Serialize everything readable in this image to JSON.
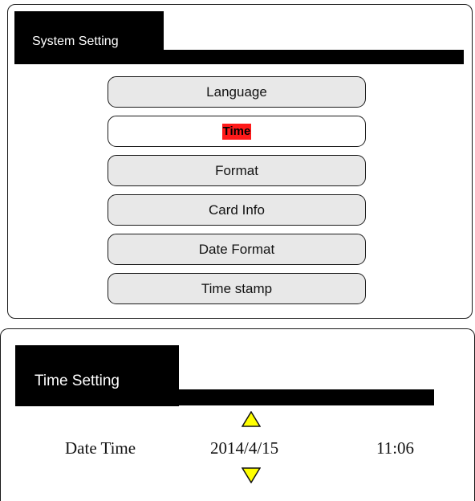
{
  "system_setting": {
    "title": "System Setting",
    "menu": [
      {
        "label": "Language",
        "selected": false
      },
      {
        "label": "Time",
        "selected": true
      },
      {
        "label": "Format",
        "selected": false
      },
      {
        "label": "Card Info",
        "selected": false
      },
      {
        "label": "Date Format",
        "selected": false
      },
      {
        "label": "Time stamp",
        "selected": false
      }
    ],
    "highlight_color": "#ff1a1a"
  },
  "time_setting": {
    "title": "Time Setting",
    "row_label": "Date Time",
    "date_value": "2014/4/15",
    "time_value": "11:06",
    "arrow_color": "#ffff00"
  }
}
